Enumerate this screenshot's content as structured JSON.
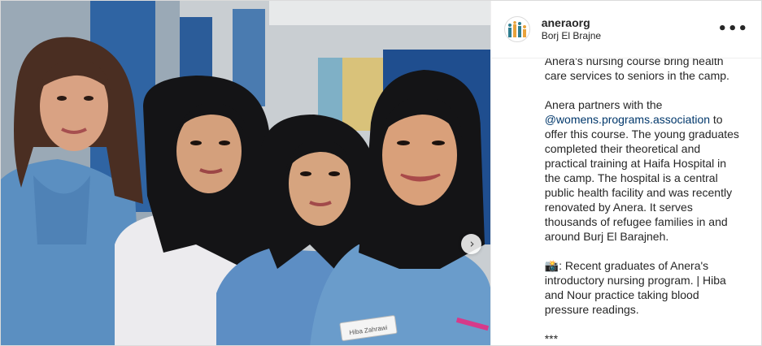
{
  "post": {
    "username": "aneraorg",
    "location": "Borj El Brajne",
    "more_label": "•••",
    "next_label": "›",
    "caption": {
      "p1": "Anera's nursing course bring health care services to seniors in the camp.",
      "p2_before": "Anera partners with the ",
      "p2_mention": "@womens.programs.association",
      "p2_after": " to offer this course. The young graduates completed their theoretical and practical training at Haifa Hospital in the camp. The hospital is a central public health facility and was recently renovated by Anera. It serves thousands of refugee families in and around Burj El Barajneh.",
      "p3": "📸: Recent graduates of Anera's introductory nursing program. | Hiba and Nour practice taking blood pressure readings.",
      "p4": "***"
    },
    "badge_text": "Hiba Zahrawi"
  },
  "colors": {
    "mention": "#00376b",
    "scrub_blue": "#5b8fc1",
    "hijab": "#141416",
    "wall_blue": "#2f64a3"
  }
}
